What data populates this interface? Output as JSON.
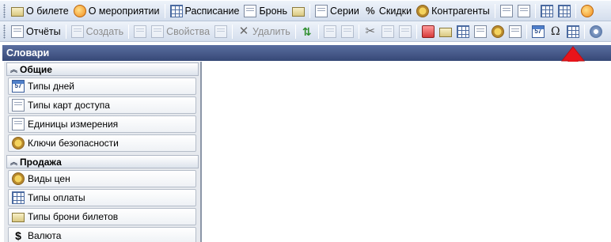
{
  "toolbar1": {
    "about_ticket": "О билете",
    "about_event": "О мероприятии",
    "schedule": "Расписание",
    "booking": "Бронь",
    "series": "Серии",
    "discounts": "Скидки",
    "counterparties": "Контрагенты"
  },
  "toolbar2": {
    "reports": "Отчёты",
    "create": "Создать",
    "properties": "Свойства",
    "delete": "Удалить"
  },
  "panel": {
    "title": "Словари",
    "groups": [
      {
        "title": "Общие",
        "items": [
          {
            "label": "Типы дней",
            "icon": "calendar-icon"
          },
          {
            "label": "Типы карт доступа",
            "icon": "card-icon"
          },
          {
            "label": "Единицы измерения",
            "icon": "ruler-icon"
          },
          {
            "label": "Ключи безопасности",
            "icon": "key-icon"
          }
        ]
      },
      {
        "title": "Продажа",
        "items": [
          {
            "label": "Виды цен",
            "icon": "coins-icon"
          },
          {
            "label": "Типы оплаты",
            "icon": "payment-icon"
          },
          {
            "label": "Типы брони билетов",
            "icon": "ticket-booking-icon"
          },
          {
            "label": "Валюта",
            "icon": "dollar-icon"
          }
        ]
      }
    ]
  },
  "annotation": {
    "arrow_color": "#e8141a"
  }
}
